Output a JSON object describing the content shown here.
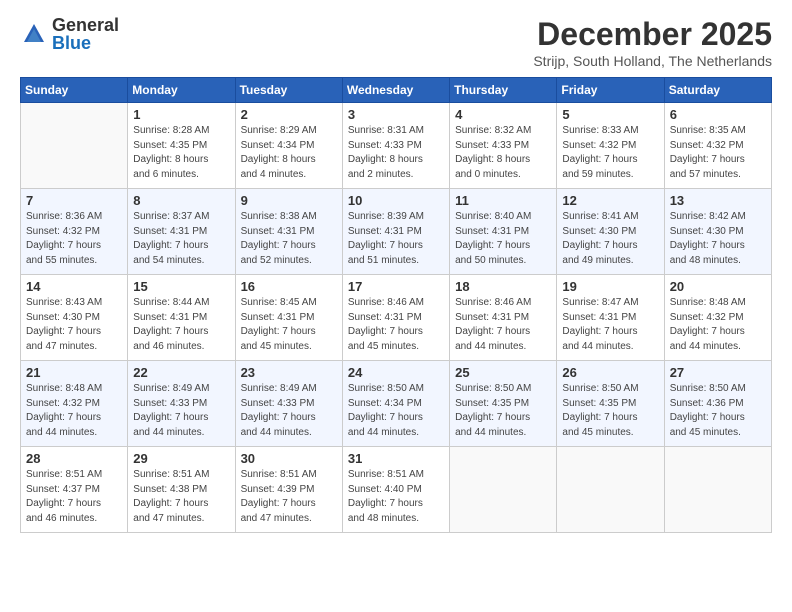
{
  "logo": {
    "general": "General",
    "blue": "Blue"
  },
  "title": {
    "month": "December 2025",
    "location": "Strijp, South Holland, The Netherlands"
  },
  "weekdays": [
    "Sunday",
    "Monday",
    "Tuesday",
    "Wednesday",
    "Thursday",
    "Friday",
    "Saturday"
  ],
  "weeks": [
    [
      {
        "day": "",
        "content": ""
      },
      {
        "day": "1",
        "content": "Sunrise: 8:28 AM\nSunset: 4:35 PM\nDaylight: 8 hours\nand 6 minutes."
      },
      {
        "day": "2",
        "content": "Sunrise: 8:29 AM\nSunset: 4:34 PM\nDaylight: 8 hours\nand 4 minutes."
      },
      {
        "day": "3",
        "content": "Sunrise: 8:31 AM\nSunset: 4:33 PM\nDaylight: 8 hours\nand 2 minutes."
      },
      {
        "day": "4",
        "content": "Sunrise: 8:32 AM\nSunset: 4:33 PM\nDaylight: 8 hours\nand 0 minutes."
      },
      {
        "day": "5",
        "content": "Sunrise: 8:33 AM\nSunset: 4:32 PM\nDaylight: 7 hours\nand 59 minutes."
      },
      {
        "day": "6",
        "content": "Sunrise: 8:35 AM\nSunset: 4:32 PM\nDaylight: 7 hours\nand 57 minutes."
      }
    ],
    [
      {
        "day": "7",
        "content": "Sunrise: 8:36 AM\nSunset: 4:32 PM\nDaylight: 7 hours\nand 55 minutes."
      },
      {
        "day": "8",
        "content": "Sunrise: 8:37 AM\nSunset: 4:31 PM\nDaylight: 7 hours\nand 54 minutes."
      },
      {
        "day": "9",
        "content": "Sunrise: 8:38 AM\nSunset: 4:31 PM\nDaylight: 7 hours\nand 52 minutes."
      },
      {
        "day": "10",
        "content": "Sunrise: 8:39 AM\nSunset: 4:31 PM\nDaylight: 7 hours\nand 51 minutes."
      },
      {
        "day": "11",
        "content": "Sunrise: 8:40 AM\nSunset: 4:31 PM\nDaylight: 7 hours\nand 50 minutes."
      },
      {
        "day": "12",
        "content": "Sunrise: 8:41 AM\nSunset: 4:30 PM\nDaylight: 7 hours\nand 49 minutes."
      },
      {
        "day": "13",
        "content": "Sunrise: 8:42 AM\nSunset: 4:30 PM\nDaylight: 7 hours\nand 48 minutes."
      }
    ],
    [
      {
        "day": "14",
        "content": "Sunrise: 8:43 AM\nSunset: 4:30 PM\nDaylight: 7 hours\nand 47 minutes."
      },
      {
        "day": "15",
        "content": "Sunrise: 8:44 AM\nSunset: 4:31 PM\nDaylight: 7 hours\nand 46 minutes."
      },
      {
        "day": "16",
        "content": "Sunrise: 8:45 AM\nSunset: 4:31 PM\nDaylight: 7 hours\nand 45 minutes."
      },
      {
        "day": "17",
        "content": "Sunrise: 8:46 AM\nSunset: 4:31 PM\nDaylight: 7 hours\nand 45 minutes."
      },
      {
        "day": "18",
        "content": "Sunrise: 8:46 AM\nSunset: 4:31 PM\nDaylight: 7 hours\nand 44 minutes."
      },
      {
        "day": "19",
        "content": "Sunrise: 8:47 AM\nSunset: 4:31 PM\nDaylight: 7 hours\nand 44 minutes."
      },
      {
        "day": "20",
        "content": "Sunrise: 8:48 AM\nSunset: 4:32 PM\nDaylight: 7 hours\nand 44 minutes."
      }
    ],
    [
      {
        "day": "21",
        "content": "Sunrise: 8:48 AM\nSunset: 4:32 PM\nDaylight: 7 hours\nand 44 minutes."
      },
      {
        "day": "22",
        "content": "Sunrise: 8:49 AM\nSunset: 4:33 PM\nDaylight: 7 hours\nand 44 minutes."
      },
      {
        "day": "23",
        "content": "Sunrise: 8:49 AM\nSunset: 4:33 PM\nDaylight: 7 hours\nand 44 minutes."
      },
      {
        "day": "24",
        "content": "Sunrise: 8:50 AM\nSunset: 4:34 PM\nDaylight: 7 hours\nand 44 minutes."
      },
      {
        "day": "25",
        "content": "Sunrise: 8:50 AM\nSunset: 4:35 PM\nDaylight: 7 hours\nand 44 minutes."
      },
      {
        "day": "26",
        "content": "Sunrise: 8:50 AM\nSunset: 4:35 PM\nDaylight: 7 hours\nand 45 minutes."
      },
      {
        "day": "27",
        "content": "Sunrise: 8:50 AM\nSunset: 4:36 PM\nDaylight: 7 hours\nand 45 minutes."
      }
    ],
    [
      {
        "day": "28",
        "content": "Sunrise: 8:51 AM\nSunset: 4:37 PM\nDaylight: 7 hours\nand 46 minutes."
      },
      {
        "day": "29",
        "content": "Sunrise: 8:51 AM\nSunset: 4:38 PM\nDaylight: 7 hours\nand 47 minutes."
      },
      {
        "day": "30",
        "content": "Sunrise: 8:51 AM\nSunset: 4:39 PM\nDaylight: 7 hours\nand 47 minutes."
      },
      {
        "day": "31",
        "content": "Sunrise: 8:51 AM\nSunset: 4:40 PM\nDaylight: 7 hours\nand 48 minutes."
      },
      {
        "day": "",
        "content": ""
      },
      {
        "day": "",
        "content": ""
      },
      {
        "day": "",
        "content": ""
      }
    ]
  ]
}
